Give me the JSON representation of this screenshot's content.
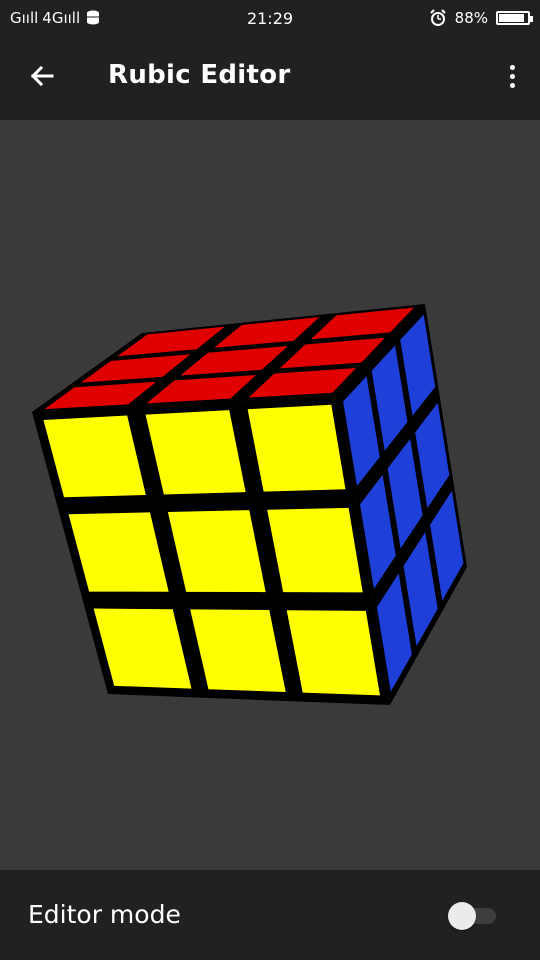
{
  "status_bar": {
    "signal1": "Gııll",
    "signal2": "4Gııll",
    "time": "21:29",
    "battery_percent": "88%",
    "battery_level": 0.88,
    "icons": [
      "signal-icon",
      "data-icon",
      "alarm-icon",
      "battery-icon"
    ]
  },
  "app_bar": {
    "title": "Rubic Editor",
    "back_icon": "arrow-left-icon",
    "menu_icon": "more-vert-icon"
  },
  "cube": {
    "colors": {
      "top": "#e00000",
      "front": "#ffff00",
      "right": "#1e3fd8",
      "frame": "#000000"
    },
    "faces": {
      "top": [
        [
          "red",
          "red",
          "red"
        ],
        [
          "red",
          "red",
          "red"
        ],
        [
          "red",
          "red",
          "red"
        ]
      ],
      "front": [
        [
          "yellow",
          "yellow",
          "yellow"
        ],
        [
          "yellow",
          "yellow",
          "yellow"
        ],
        [
          "yellow",
          "yellow",
          "yellow"
        ]
      ],
      "right": [
        [
          "blue",
          "blue",
          "blue"
        ],
        [
          "blue",
          "blue",
          "blue"
        ],
        [
          "blue",
          "blue",
          "blue"
        ]
      ]
    }
  },
  "editor": {
    "label": "Editor mode",
    "enabled": false
  },
  "theme": {
    "background": "#3a3a3a",
    "bars": "#212121"
  }
}
